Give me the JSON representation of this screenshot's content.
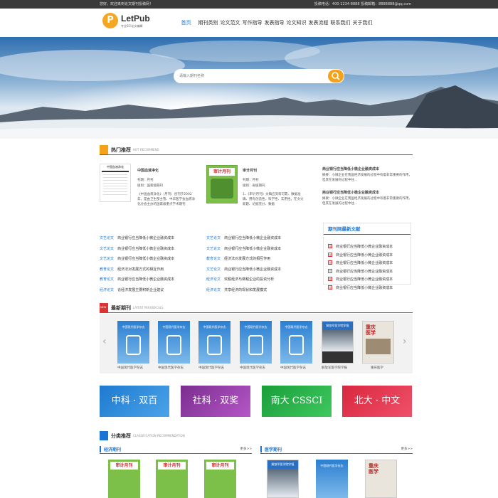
{
  "topbar": {
    "welcome": "您好，欢迎来到论文期刊投稿网！",
    "contact": "投稿电话：400-1234-8888 投稿邮箱：8888888@qq.com"
  },
  "brand": {
    "logo_letter": "P",
    "name": "LetPub",
    "tagline": "专业SCI论文编辑"
  },
  "nav": [
    "首页",
    "期刊类别",
    "论文范文",
    "写作指导",
    "发表指导",
    "论文知识",
    "发表流程",
    "联系我们",
    "关于我们"
  ],
  "search": {
    "placeholder": "请输入期刊名称"
  },
  "hot": {
    "title": "热门推荐",
    "subtitle": "HOT RECOMMEND",
    "item1": {
      "cover": "中国血液净化",
      "name": "中国血液净化",
      "freq": "刊期：月刊",
      "level": "级别：国家级期刊",
      "desc": "《中国血液净化》（月刊）创刊于2002年，是由卫生部主管、中华医学会血液净化分会主办的国家级重点学术期刊"
    },
    "item2": {
      "cover": "审计月刊",
      "name": "审计月刊",
      "freq": "刊期：月刊",
      "level": "级别：省级期刊",
      "desc": "1、《审计月刊》文稿应资料可靠、数据准确、用有创造性、科学性、实用性。在文论新题、论据充分、数据"
    },
    "news": [
      {
        "title": "商业银行应当降低小微企业融资成本",
        "desc": "摘要：小微企业在我国经济发展的过程中有着非常重要的作用，但其在发展的过程中往..."
      },
      {
        "title": "商业银行应当降低小微企业融资成本",
        "desc": "摘要：小微企业在我国经济发展的过程中有着非常重要的作用，但其在发展的过程中往..."
      }
    ]
  },
  "list_left": [
    [
      "文艺论文",
      "商业银行应当降低小微企业融资成本"
    ],
    [
      "文艺论文",
      "商业银行应当降低小微企业融资成本"
    ],
    [
      "文艺论文",
      "商业银行应当降低小微企业融资成本"
    ],
    [
      "教育论文",
      "经济法对发展方式的相互作用"
    ],
    [
      "教育论文",
      "商业银行应当降低小微企业融资成本"
    ],
    [
      "经济论文",
      "论经济发展主要积新企业建议"
    ]
  ],
  "list_mid": [
    [
      "文艺论文",
      "商业银行应当降低小微企业融资成本"
    ],
    [
      "文艺论文",
      "商业银行应当降低小微企业融资成本"
    ],
    [
      "教育论文",
      "经济法对发展方式的相互作用"
    ],
    [
      "文艺论文",
      "商业银行应当降低小微企业融资成本"
    ],
    [
      "经济论文",
      "欢税经济与做税企业的投资分析"
    ],
    [
      "经济论文",
      "共享经济的现状和发展模式"
    ]
  ],
  "latest_docs": {
    "title": "期刊网最新文献",
    "items": [
      [
        "文",
        "商业银行应当降低小微企业融资成本"
      ],
      [
        "文",
        "商业银行应当降低小微企业融资成本"
      ],
      [
        "文",
        "商业银行应当降低小微企业融资成本"
      ],
      [
        "大",
        "商业银行应当降低小微企业融资成本"
      ],
      [
        "文",
        "商业银行应当降低小微企业融资成本"
      ],
      [
        "文",
        "商业银行应当降低小微企业融资成本"
      ]
    ]
  },
  "periodicals": {
    "title": "最新期刊",
    "subtitle": "LATEST PERIODICALS",
    "items": [
      "中国现代医学杂志",
      "中国现代医学杂志",
      "中国现代医学杂志",
      "中国现代医学杂志",
      "中国现代医学杂志",
      "解放军医学院学报",
      "重庆医学"
    ],
    "prev": "‹",
    "next": "›"
  },
  "banners": [
    "中科 · 双百",
    "社科 · 双奖",
    "南大 CSSCI",
    "北大 · 中文"
  ],
  "classify": {
    "title": "分类推荐",
    "subtitle": "CLASSIFICATION RECOMMENDATION",
    "left": {
      "title": "经济期刊",
      "more": "更多>>"
    },
    "right": {
      "title": "医学期刊",
      "more": "更多>>"
    }
  },
  "cover_texts": {
    "shenji": "审计月刊",
    "xiandai": "中国现代医学杂志",
    "jiefangjun": "解放军医学院学报",
    "chongqing": "重庆医学",
    "nu": "NEW"
  },
  "colors": {
    "accent": "#1a74d6",
    "orange": "#f5a21a"
  }
}
